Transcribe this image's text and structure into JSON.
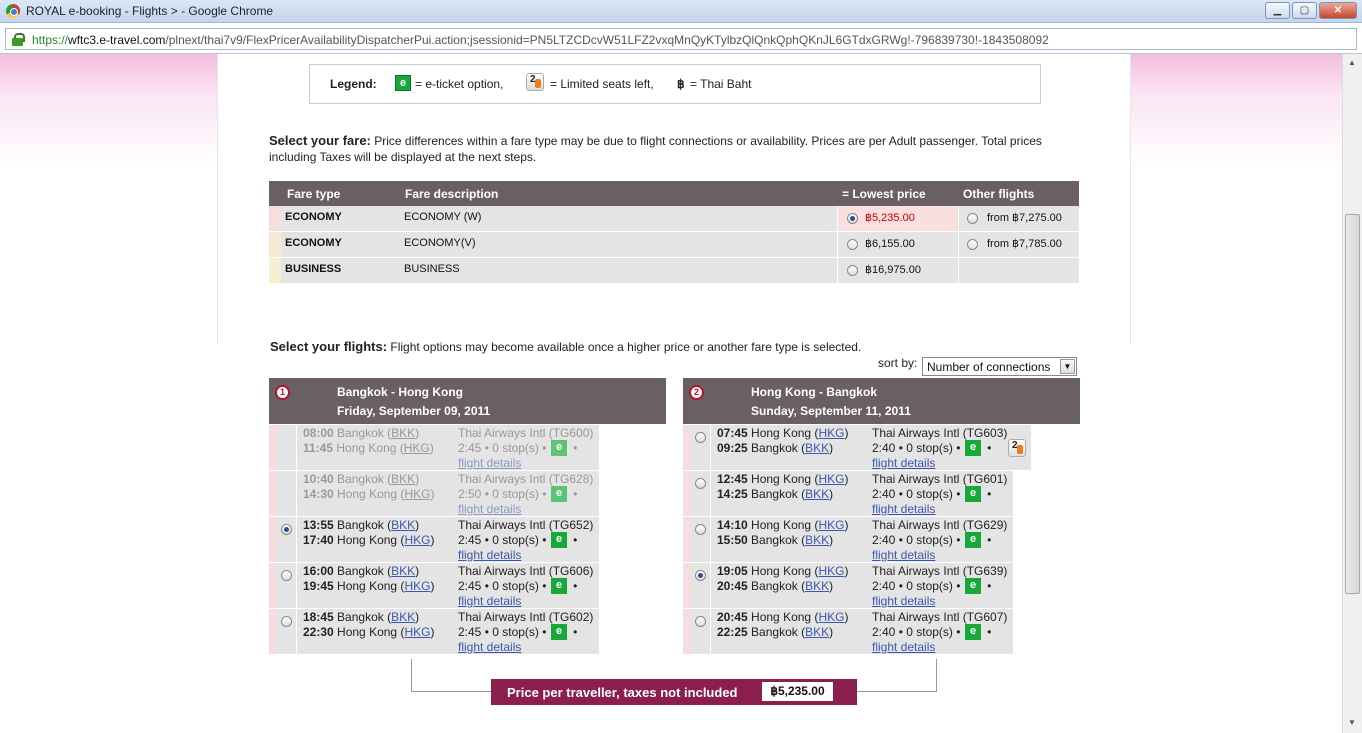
{
  "window": {
    "title": "ROYAL e-booking - Flights > - Google Chrome",
    "min": "▁",
    "max": "▢",
    "close": "✕"
  },
  "address": {
    "scheme": "https://",
    "host": "wftc3.e-travel.com",
    "path": "/plnext/thai7v9/FlexPricerAvailabilityDispatcherPui.action;jsessionid=PN5LTZCDcvW51LFZ2vxqMnQyKTylbzQlQnkQphQKnJL6GTdxGRWg!-796839730!-1843508092"
  },
  "legend": {
    "title": "Legend:",
    "e_label": "= e-ticket option,",
    "seats_label": "= Limited seats left,",
    "baht_symbol": "฿",
    "baht_label": "= Thai Baht",
    "e_symbol": "e"
  },
  "fare_select": {
    "heading": "Select your fare:",
    "text": "Price differences within a fare type may be due to flight connections or availability. Prices are per Adult passenger. Total prices",
    "text2": "including Taxes will be displayed at the next steps."
  },
  "fare_table": {
    "headers": [
      "Fare type",
      "Fare description",
      "= Lowest price",
      "Other flights"
    ],
    "rows": [
      {
        "type": "ECONOMY",
        "desc": "ECONOMY (W)",
        "price": "฿5,235.00",
        "other": "from ฿7,275.00",
        "selected": true
      },
      {
        "type": "ECONOMY",
        "desc": "ECONOMY(V)",
        "price": "฿6,155.00",
        "other": "from ฿7,785.00",
        "selected": false
      },
      {
        "type": "BUSINESS",
        "desc": "BUSINESS",
        "price": "฿16,975.00",
        "other": "",
        "selected": false
      }
    ]
  },
  "flight_select": {
    "heading": "Select your flights:",
    "text": "Flight options may become available once a higher price or another fare type is selected."
  },
  "sort": {
    "label": "sort by:",
    "value": "Number of connections",
    "arrow": "▼"
  },
  "outbound": {
    "num": "1",
    "route": "Bangkok - Hong Kong",
    "date": "Friday, September 09, 2011",
    "flights": [
      {
        "dep": "08:00",
        "from": "Bangkok",
        "from_code": "BKK",
        "arr": "11:45",
        "to": "Hong Kong",
        "to_code": "HKG",
        "airline": "Thai Airways Intl (TG600)",
        "duration": "2:45",
        "stops": "0 stop(s)",
        "details": "flight details",
        "disabled": true,
        "selected": false
      },
      {
        "dep": "10:40",
        "from": "Bangkok",
        "from_code": "BKK",
        "arr": "14:30",
        "to": "Hong Kong",
        "to_code": "HKG",
        "airline": "Thai Airways Intl (TG628)",
        "duration": "2:50",
        "stops": "0 stop(s)",
        "details": "flight details",
        "disabled": true,
        "selected": false
      },
      {
        "dep": "13:55",
        "from": "Bangkok",
        "from_code": "BKK",
        "arr": "17:40",
        "to": "Hong Kong",
        "to_code": "HKG",
        "airline": "Thai Airways Intl (TG652)",
        "duration": "2:45",
        "stops": "0 stop(s)",
        "details": "flight details",
        "disabled": false,
        "selected": true
      },
      {
        "dep": "16:00",
        "from": "Bangkok",
        "from_code": "BKK",
        "arr": "19:45",
        "to": "Hong Kong",
        "to_code": "HKG",
        "airline": "Thai Airways Intl (TG606)",
        "duration": "2:45",
        "stops": "0 stop(s)",
        "details": "flight details",
        "disabled": false,
        "selected": false
      },
      {
        "dep": "18:45",
        "from": "Bangkok",
        "from_code": "BKK",
        "arr": "22:30",
        "to": "Hong Kong",
        "to_code": "HKG",
        "airline": "Thai Airways Intl (TG602)",
        "duration": "2:45",
        "stops": "0 stop(s)",
        "details": "flight details",
        "disabled": false,
        "selected": false
      }
    ]
  },
  "inbound": {
    "num": "2",
    "route": "Hong Kong - Bangkok",
    "date": "Sunday, September 11, 2011",
    "flights": [
      {
        "dep": "07:45",
        "from": "Hong Kong",
        "from_code": "HKG",
        "arr": "09:25",
        "to": "Bangkok",
        "to_code": "BKK",
        "airline": "Thai Airways Intl (TG603)",
        "duration": "2:40",
        "stops": "0 stop(s)",
        "details": "flight details",
        "disabled": false,
        "selected": false,
        "limited": true
      },
      {
        "dep": "12:45",
        "from": "Hong Kong",
        "from_code": "HKG",
        "arr": "14:25",
        "to": "Bangkok",
        "to_code": "BKK",
        "airline": "Thai Airways Intl (TG601)",
        "duration": "2:40",
        "stops": "0 stop(s)",
        "details": "flight details",
        "disabled": false,
        "selected": false,
        "limited": false
      },
      {
        "dep": "14:10",
        "from": "Hong Kong",
        "from_code": "HKG",
        "arr": "15:50",
        "to": "Bangkok",
        "to_code": "BKK",
        "airline": "Thai Airways Intl (TG629)",
        "duration": "2:40",
        "stops": "0 stop(s)",
        "details": "flight details",
        "disabled": false,
        "selected": false,
        "limited": false
      },
      {
        "dep": "19:05",
        "from": "Hong Kong",
        "from_code": "HKG",
        "arr": "20:45",
        "to": "Bangkok",
        "to_code": "BKK",
        "airline": "Thai Airways Intl (TG639)",
        "duration": "2:40",
        "stops": "0 stop(s)",
        "details": "flight details",
        "disabled": false,
        "selected": true,
        "limited": false
      },
      {
        "dep": "20:45",
        "from": "Hong Kong",
        "from_code": "HKG",
        "arr": "22:25",
        "to": "Bangkok",
        "to_code": "BKK",
        "airline": "Thai Airways Intl (TG607)",
        "duration": "2:40",
        "stops": "0 stop(s)",
        "details": "flight details",
        "disabled": false,
        "selected": false,
        "limited": false
      }
    ]
  },
  "price_bar": {
    "label": "Price per traveller, taxes not included",
    "value": "฿5,235.00"
  },
  "colors": {
    "header": "#6b5f66",
    "price_bar": "#8a1e4c",
    "eticket": "#18a83a",
    "selected_price": "#cc0000"
  }
}
